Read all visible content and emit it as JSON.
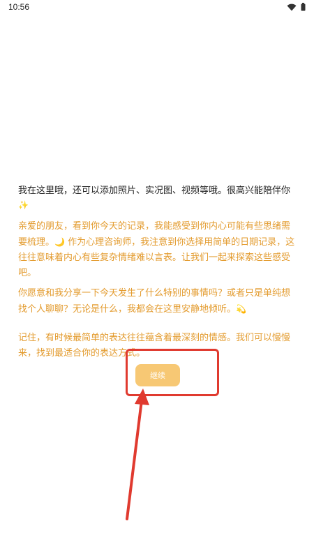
{
  "status_bar": {
    "time": "10:56"
  },
  "chat": {
    "intro": "我在这里哦，还可以添加照片、实况图、视频等哦。很高兴能陪伴你",
    "intro_emoji": "✨",
    "paragraph_1_a": "亲爱的朋友，看到你今天的记录，我能感受到你内心可能有些思绪需要梳理。",
    "paragraph_1_emoji": "🌙",
    "paragraph_1_b": " 作为心理咨询师，我注意到你选择用简单的日期记录，这往往意味着内心有些复杂情绪难以言表。让我们一起来探索这些感受吧。",
    "paragraph_2": "你愿意和我分享一下今天发生了什么特别的事情吗？或者只是单纯想找个人聊聊？无论是什么，我都会在这里安静地倾听。",
    "paragraph_2_emoji": "💫",
    "paragraph_3": "记住，有时候最简单的表达往往蕴含着最深刻的情感。我们可以慢慢来，找到最适合你的表达方式。"
  },
  "continue_button": {
    "label": "继续"
  },
  "icons": {
    "status": [
      "wifi-icon",
      "battery-icon"
    ]
  },
  "colors": {
    "message_text": "#e39b2e",
    "button_bg": "#f7c874",
    "annotation": "#e03a2f"
  }
}
